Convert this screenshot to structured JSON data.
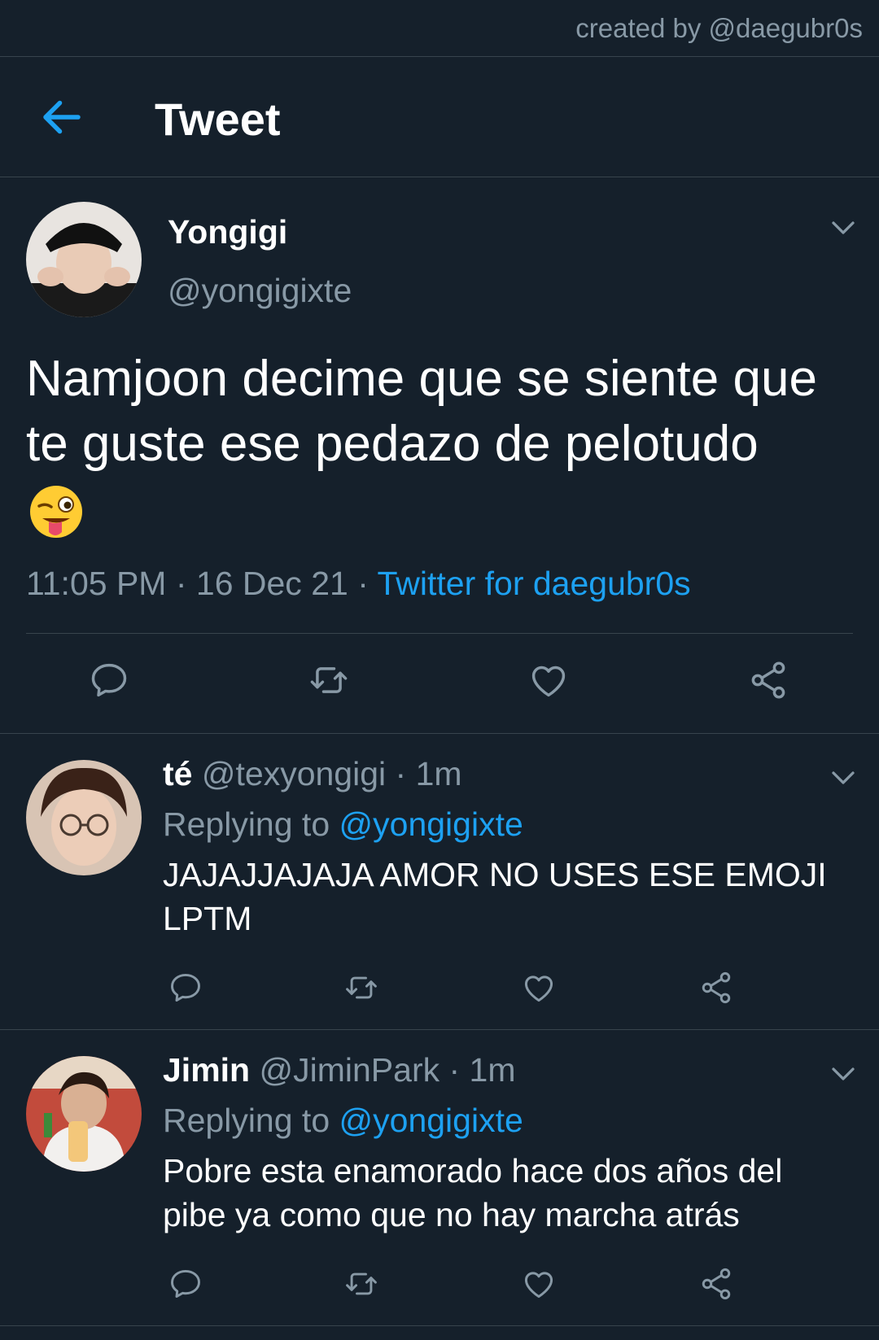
{
  "credit": "created by @daegubr0s",
  "header": {
    "title": "Tweet"
  },
  "main_tweet": {
    "name": "Yongigi",
    "handle": "@yongigixte",
    "text": "Namjoon decime que se siente que te guste ese pedazo de pelotudo",
    "emoji": "winking-face-with-tongue",
    "time": "11:05 PM",
    "date": "16 Dec 21",
    "source": "Twitter for daegubr0s"
  },
  "replies": [
    {
      "name": "té",
      "handle": "@texyongigi",
      "age": "1m",
      "replying_label": "Replying to",
      "replying_to": "@yongigixte",
      "text": "JAJAJJAJAJA AMOR NO USES ESE EMOJI LPTM"
    },
    {
      "name": "Jimin",
      "handle": "@JiminPark",
      "age": "1m",
      "replying_label": "Replying to",
      "replying_to": "@yongigixte",
      "text": "Pobre esta enamorado hace dos años del pibe ya como que no hay marcha atrás"
    }
  ],
  "colors": {
    "background": "#15202b",
    "accent": "#1da1f2",
    "muted": "#8899a6",
    "divider": "#38444d"
  },
  "icons": [
    "back-arrow-icon",
    "chevron-down-icon",
    "reply-icon",
    "retweet-icon",
    "like-icon",
    "share-icon"
  ]
}
